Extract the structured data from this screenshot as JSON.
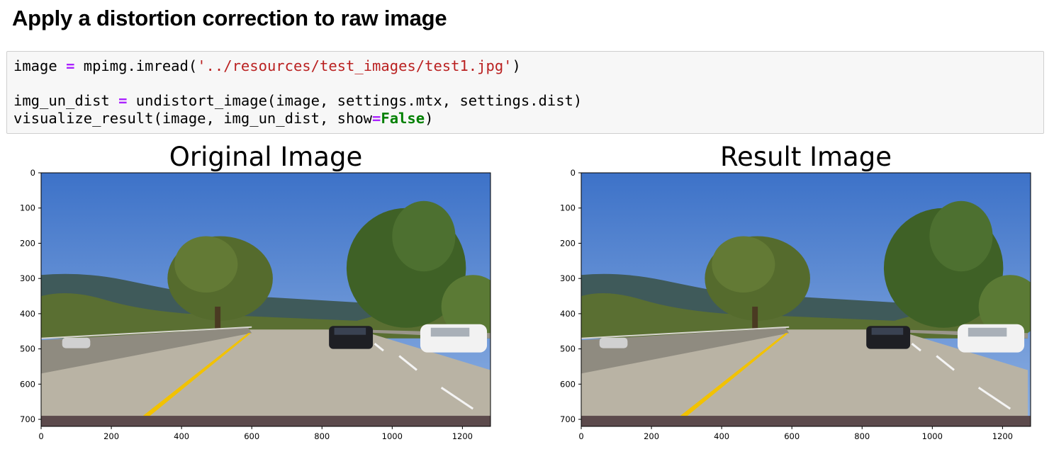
{
  "heading": "Apply a distortion correction to raw image",
  "code": {
    "line1": {
      "a": "image ",
      "op": "=",
      "b": " mpimg.imread(",
      "str": "'../resources/test_images/test1.jpg'",
      "c": ")"
    },
    "line2": {
      "a": "img_un_dist ",
      "op": "=",
      "b": " undistort_image(image, settings.mtx, settings.dist)"
    },
    "line3": {
      "a": "visualize_result(image, img_un_dist, show",
      "op": "=",
      "kw": "False",
      "c": ")"
    }
  },
  "colors": {
    "sky": "#4a7fd0",
    "road": "#b9b3a4",
    "lane_yellow": "#f2c200",
    "tree": "#4f6a2c"
  },
  "chart_data": [
    {
      "type": "image",
      "title": "Original Image",
      "x_ticks": [
        "0",
        "200",
        "400",
        "600",
        "800",
        "1000",
        "1200"
      ],
      "y_ticks": [
        "0",
        "100",
        "200",
        "300",
        "400",
        "500",
        "600",
        "700"
      ],
      "xlim": [
        0,
        1280
      ],
      "ylim": [
        720,
        0
      ]
    },
    {
      "type": "image",
      "title": "Result Image",
      "x_ticks": [
        "0",
        "200",
        "400",
        "600",
        "800",
        "1000",
        "1200"
      ],
      "y_ticks": [
        "0",
        "100",
        "200",
        "300",
        "400",
        "500",
        "600",
        "700"
      ],
      "xlim": [
        0,
        1280
      ],
      "ylim": [
        720,
        0
      ]
    }
  ]
}
